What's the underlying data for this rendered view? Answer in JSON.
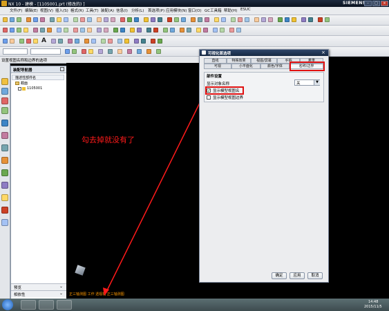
{
  "window": {
    "title": "NX 10 - 建模 - [1105001.prt  (修改的) ]",
    "brand": "SIEMENS",
    "controls": [
      "–",
      "□",
      "×"
    ]
  },
  "menu": [
    "文件(F)",
    "编辑(E)",
    "视图(V)",
    "插入(S)",
    "格式(R)",
    "工具(T)",
    "装配(A)",
    "信息(I)",
    "分析(L)",
    "首选项(P)",
    "应用模块(N)",
    "窗口(O)",
    "GC工具箱",
    "帮助(H)",
    "ESUC"
  ],
  "status_bar_top": "设置视图名称和边界的选项",
  "navigator": {
    "title": "装配导航器",
    "column_header": "描述性部件名",
    "items": [
      "截面",
      "1105001"
    ],
    "bottom_sections": [
      "预览",
      "相依性"
    ]
  },
  "dialog": {
    "title": "可视化首选项",
    "tabs_row1": [
      "直线",
      "特殊效果",
      "视图/屏幕",
      "手柄",
      "着重"
    ],
    "tabs_row2": [
      "可视",
      "小平面化",
      "颜色/字体",
      "名称/边界"
    ],
    "group_title": "部件设置",
    "field_label": "显示对象名称",
    "field_value": "关",
    "checkbox_show_view_name": {
      "label": "显示模型视图名",
      "checked": true
    },
    "checkbox_show_view_border": {
      "label": "显示模型视图边界",
      "checked": false
    },
    "buttons": {
      "ok": "确定",
      "apply": "应用",
      "cancel": "取消"
    }
  },
  "annotation": "勾去掉就没有了",
  "viewport_label": "正三轴测图 工作  透视机  正三轴测图",
  "clock": {
    "time": "14:48",
    "date": "2015/11/5"
  },
  "colors": {
    "annotation_red": "#ff1a1a",
    "viewport_label": "#ff9900"
  }
}
